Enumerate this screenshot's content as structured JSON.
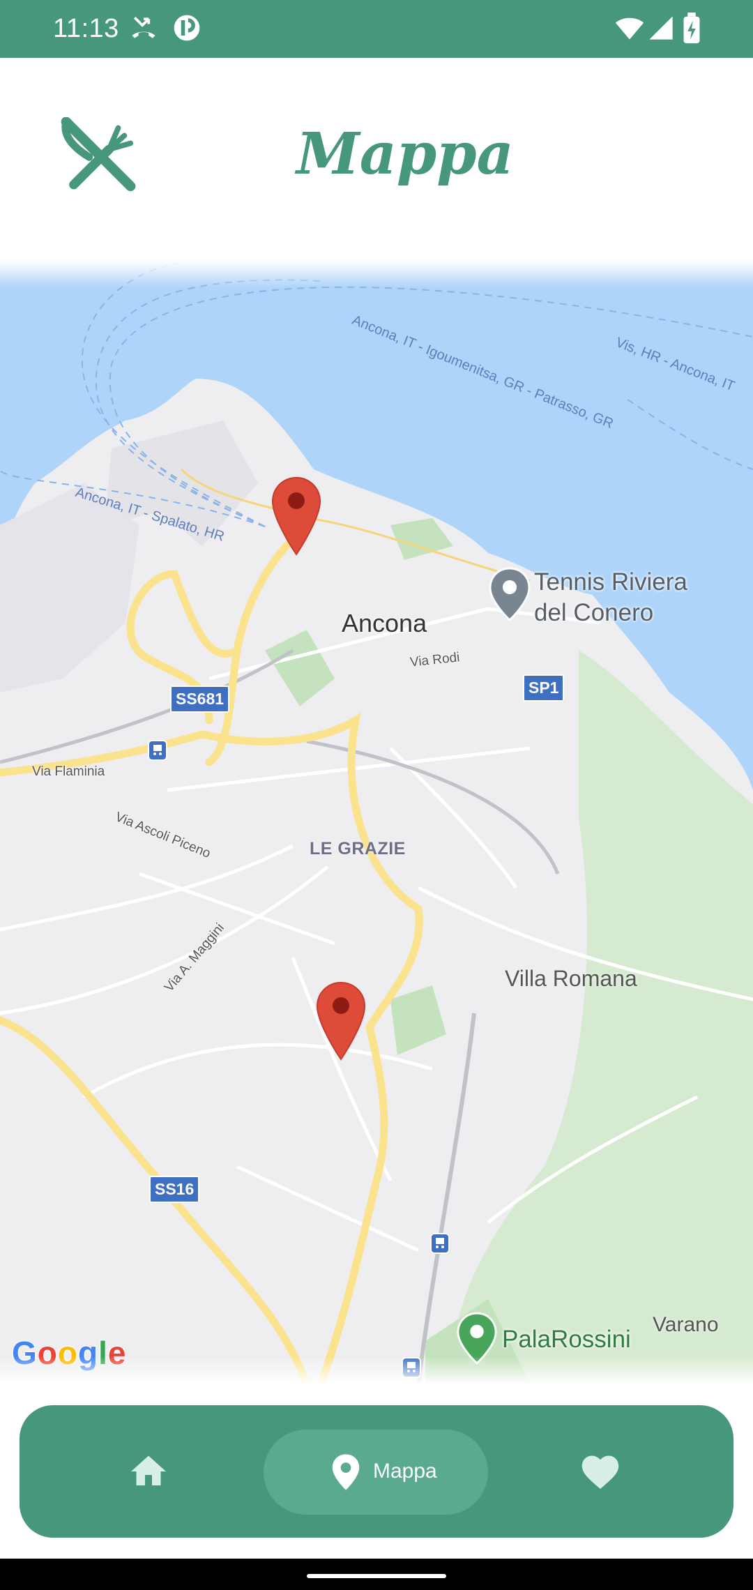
{
  "status_bar": {
    "time": "11:13",
    "icons": [
      "missed-call-icon",
      "app-notification-icon",
      "wifi-icon",
      "signal-icon",
      "battery-charging-icon"
    ]
  },
  "header": {
    "logo_icon": "fork-knife-icon",
    "title": "Mappa"
  },
  "map": {
    "provider_logo": "Google",
    "city_label": "Ancona",
    "poi_labels": {
      "tennis_line1": "Tennis Riviera",
      "tennis_line2": "del Conero",
      "palarossini": "PalaRossini"
    },
    "area_labels": {
      "villa_romana": "Villa Romana",
      "varano": "Varano",
      "le_grazie": "LE GRAZIE"
    },
    "street_labels": {
      "via_rodi": "Via Rodi",
      "via_flaminia": "Via Flaminia",
      "via_ascoli_piceno": "Via Ascoli Piceno",
      "via_maggini": "Via A. Maggini"
    },
    "road_shields": {
      "ss681": "SS681",
      "sp1": "SP1",
      "ss16": "SS16"
    },
    "ferry_labels": {
      "igoumenitsa": "Ancona, IT - Igoumenitsa, GR - Patrasso, GR",
      "vis": "Vis, HR - Ancona, IT",
      "spalato": "Ancona, IT - Spalato, HR"
    },
    "marker_count": 2,
    "colors": {
      "water": "#aed4fa",
      "land": "#eeedf0",
      "road_major": "#fbe28c",
      "park": "#cfe8c9",
      "marker": "#de4b39"
    }
  },
  "bottom_nav": {
    "items": [
      {
        "icon": "home-icon",
        "label": ""
      },
      {
        "icon": "map-pin-icon",
        "label": "Mappa",
        "active": true
      },
      {
        "icon": "heart-icon",
        "label": ""
      }
    ]
  },
  "theme": {
    "primary": "#46977b",
    "active_pill": "#5aaa90"
  }
}
